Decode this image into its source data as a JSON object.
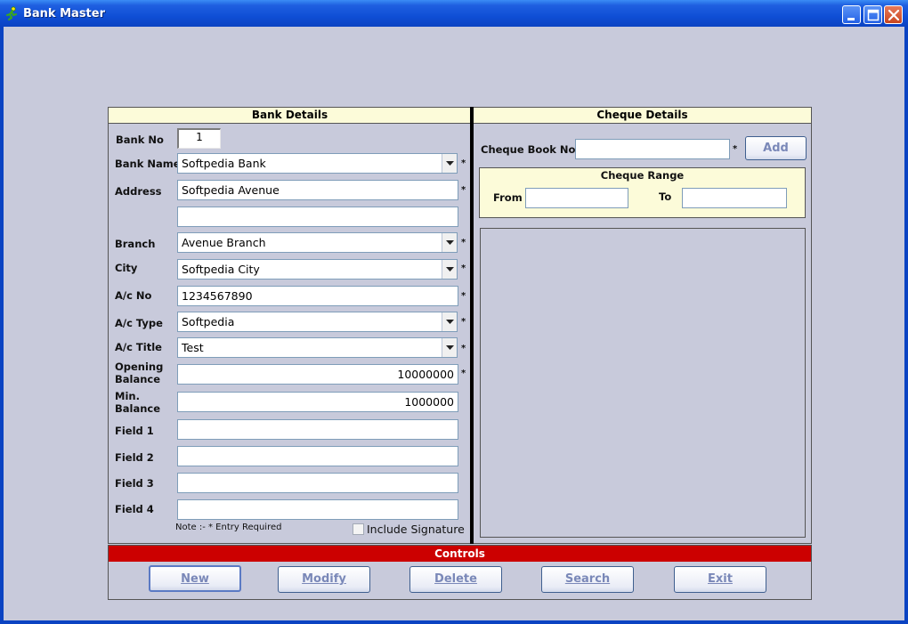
{
  "window": {
    "title": "Bank Master"
  },
  "bank_details": {
    "header": "Bank Details",
    "bank_no": {
      "label": "Bank No",
      "value": "1"
    },
    "bank_name": {
      "label": "Bank Name",
      "value": "Softpedia Bank"
    },
    "address": {
      "label": "Address",
      "line1": "Softpedia Avenue",
      "line2": ""
    },
    "branch": {
      "label": "Branch",
      "value": "Avenue Branch"
    },
    "city": {
      "label": "City",
      "value": "Softpedia City"
    },
    "ac_no": {
      "label": "A/c No",
      "value": "1234567890"
    },
    "ac_type": {
      "label": "A/c Type",
      "value": "Softpedia"
    },
    "ac_title": {
      "label": "A/c Title",
      "value": "Test"
    },
    "opening_balance": {
      "label_line1": "Opening",
      "label_line2": "Balance",
      "value": "10000000"
    },
    "min_balance": {
      "label_line1": "Min.",
      "label_line2": "Balance",
      "value": "1000000"
    },
    "field1": {
      "label": "Field 1",
      "value": ""
    },
    "field2": {
      "label": "Field 2",
      "value": ""
    },
    "field3": {
      "label": "Field 3",
      "value": ""
    },
    "field4": {
      "label": "Field 4",
      "value": ""
    },
    "note": "Note :- * Entry Required",
    "include_signature": {
      "label": "Include Signature",
      "checked": false
    },
    "required_mark": "*"
  },
  "cheque_details": {
    "header": "Cheque Details",
    "cheque_book_no": {
      "label": "Cheque Book No.",
      "value": ""
    },
    "add_button": "Add",
    "cheque_range": {
      "title": "Cheque Range",
      "from_label": "From",
      "from_value": "",
      "to_label": "To",
      "to_value": ""
    }
  },
  "controls": {
    "header": "Controls",
    "buttons": [
      "New",
      "Modify",
      "Delete",
      "Search",
      "Exit"
    ]
  },
  "colors": {
    "controls_header": "#cc0000",
    "panel_header": "#fcfbd9",
    "titlebar": "#0b43c2"
  }
}
